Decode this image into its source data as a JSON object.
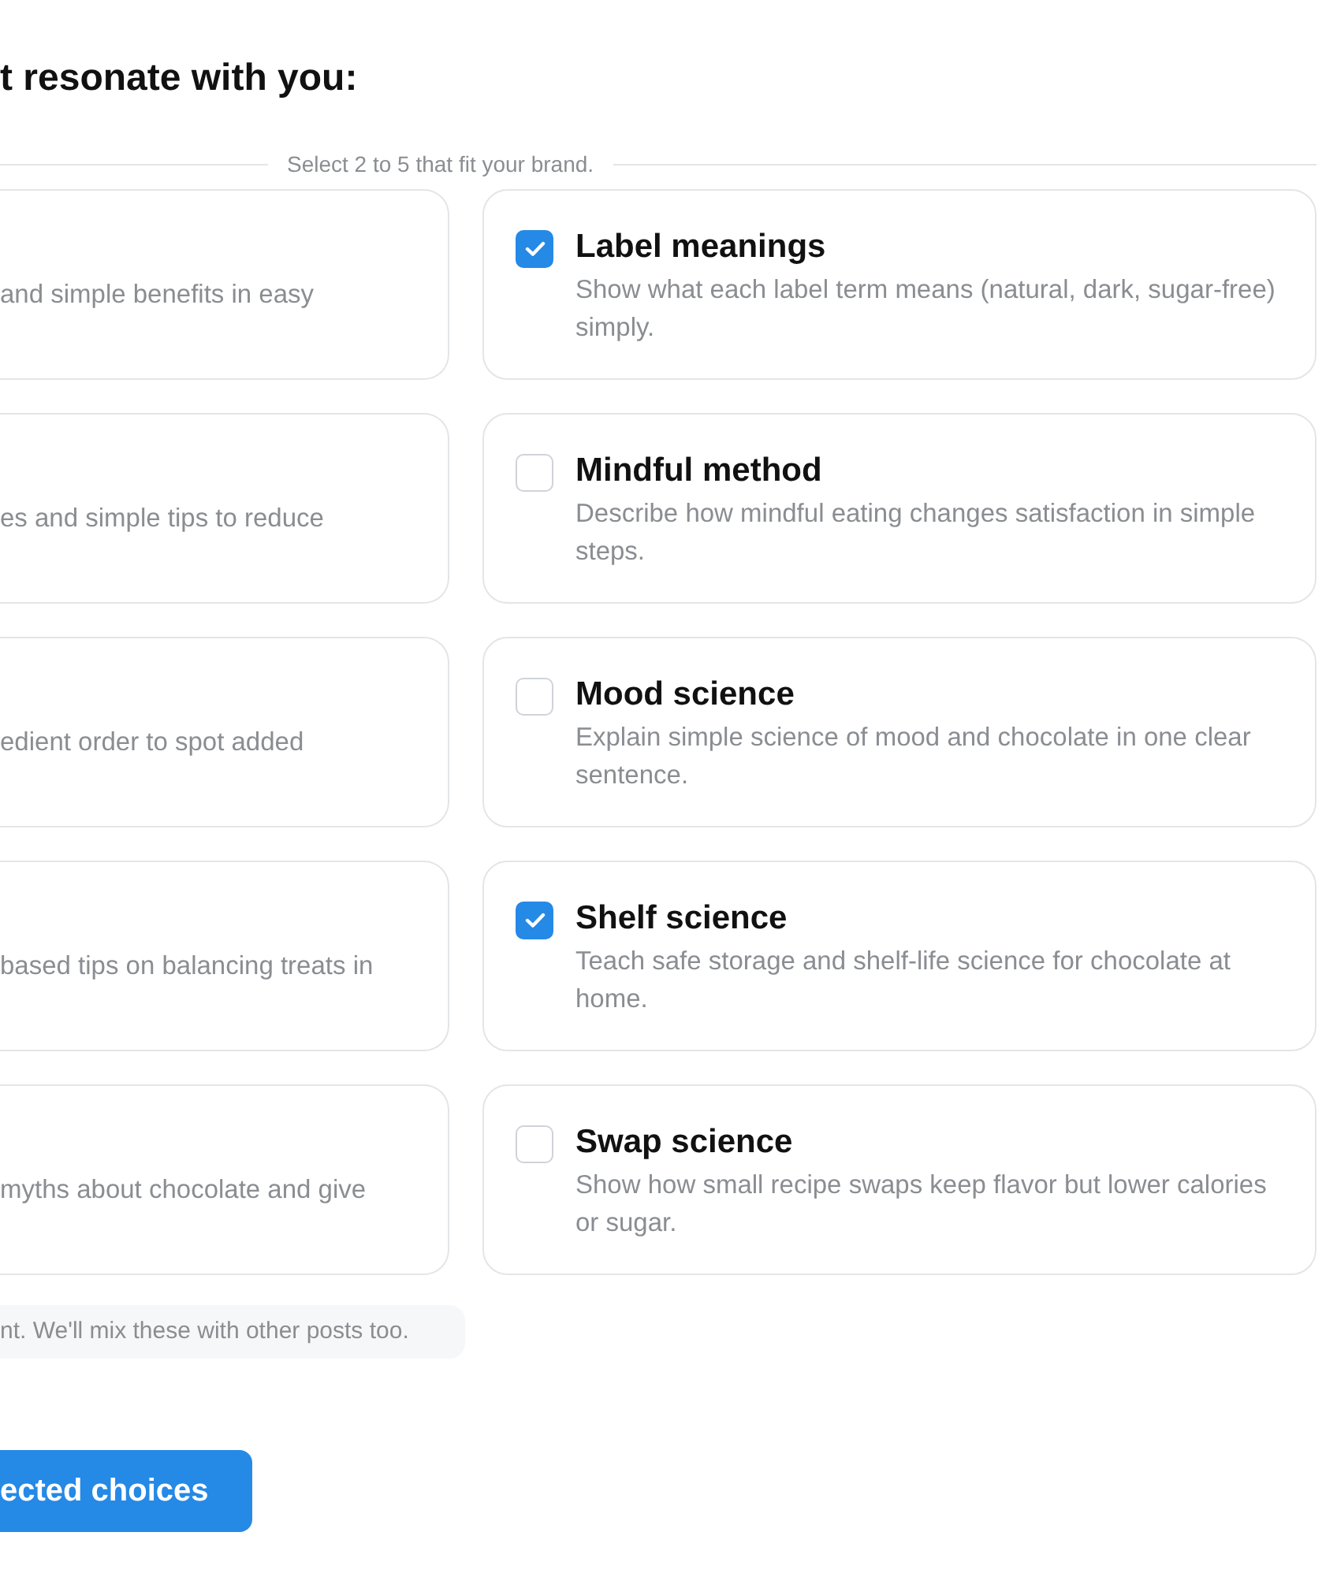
{
  "heading": "t resonate with you:",
  "instruction": "Select 2 to 5 that fit your brand.",
  "left_column": [
    {
      "description": "and simple benefits in easy"
    },
    {
      "description": "es and simple tips to reduce"
    },
    {
      "description": "edient order to spot added"
    },
    {
      "description": "based tips on balancing treats in"
    },
    {
      "description": "myths about chocolate and give"
    }
  ],
  "right_column": [
    {
      "title": "Label meanings",
      "description": "Show what each label term means (natural, dark, sugar-free) simply.",
      "checked": true
    },
    {
      "title": "Mindful method",
      "description": "Describe how mindful eating changes satisfaction in simple steps.",
      "checked": false
    },
    {
      "title": "Mood science",
      "description": "Explain simple science of mood and chocolate in one clear sentence.",
      "checked": false
    },
    {
      "title": "Shelf science",
      "description": "Teach safe storage and shelf-life science for chocolate at home.",
      "checked": true
    },
    {
      "title": "Swap science",
      "description": "Show how small recipe swaps keep flavor but lower calories or sugar.",
      "checked": false
    }
  ],
  "note": "nt. We'll mix these with other posts too.",
  "submit_button": "ected choices"
}
